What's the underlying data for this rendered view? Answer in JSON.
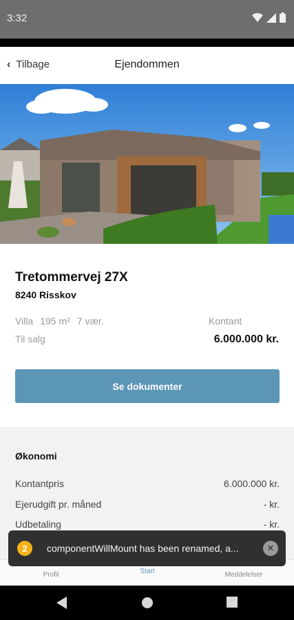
{
  "status_bar": {
    "time": "3:32"
  },
  "header": {
    "back_label": "Tilbage",
    "title": "Ejendommen"
  },
  "property": {
    "address": "Tretommervej 27X",
    "postcode_city": "8240 Risskov",
    "type": "Villa",
    "area": "195 m²",
    "rooms": "7 vær.",
    "status": "Til salg",
    "price_label": "Kontant",
    "price": "6.000.000 kr."
  },
  "actions": {
    "documents_button": "Se dokumenter"
  },
  "economy": {
    "title": "Økonomi",
    "rows": [
      {
        "label": "Kontantpris",
        "value": "6.000.000 kr."
      },
      {
        "label": "Ejerudgift pr. måned",
        "value": "- kr."
      },
      {
        "label": "Udbetaling",
        "value": "- kr."
      }
    ]
  },
  "bottom_nav": {
    "items": [
      {
        "label": "Profil"
      },
      {
        "label": "Start"
      },
      {
        "label": "Meddelelser"
      }
    ]
  },
  "toast": {
    "count": "2",
    "message": "componentWillMount has been renamed, a..."
  },
  "colors": {
    "accent": "#5b96b6",
    "toast_badge": "#f6b21a",
    "toast_bg": "#303030"
  }
}
